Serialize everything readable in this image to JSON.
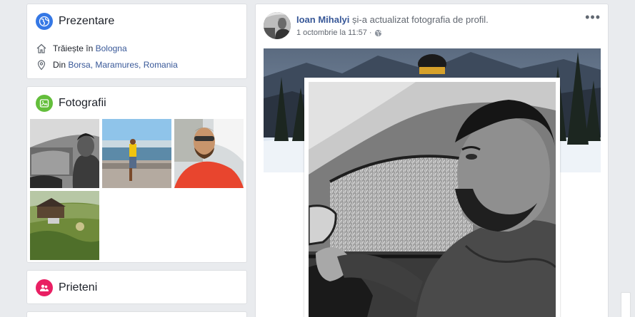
{
  "intro": {
    "title": "Prezentare",
    "lives_prefix": "Trăiește în",
    "lives_city": "Bologna",
    "from_prefix": "Din",
    "from_place": "Borsa, Maramures, Romania"
  },
  "photos": {
    "title": "Fotografii"
  },
  "friends": {
    "title": "Prieteni"
  },
  "post": {
    "author": "Ioan Mihalyi",
    "action": "și-a actualizat fotografia de profil.",
    "timestamp": "1 octombrie la 11:57",
    "more": "•••"
  },
  "colors": {
    "link": "#385898",
    "intro_icon": "#3578e5",
    "photos_icon": "#63be3b",
    "friends_icon": "#e91f63"
  }
}
